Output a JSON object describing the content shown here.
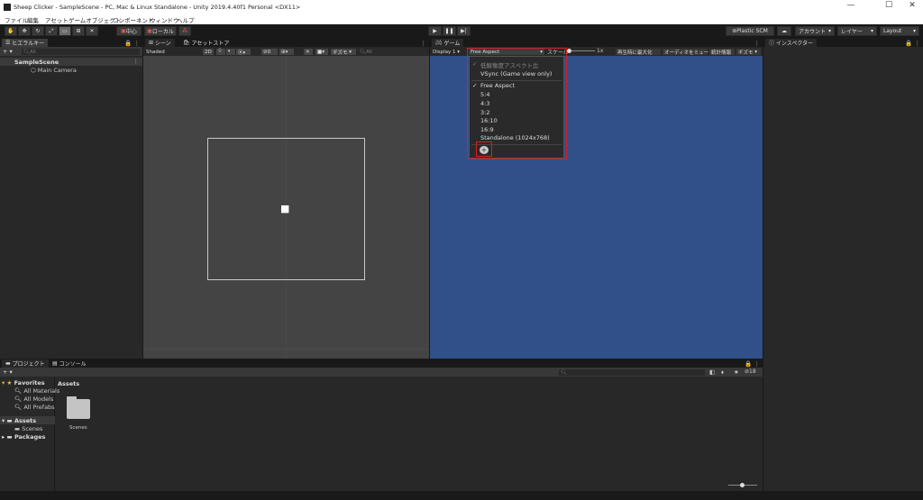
{
  "window": {
    "title": "Sheep Clicker - SampleScene - PC, Mac & Linux Standalone - Unity 2019.4.40f1 Personal <DX11>",
    "minimize": "—",
    "maximize": "☐",
    "close": "✕"
  },
  "menu": [
    "ファイル",
    "編集",
    "アセット",
    "ゲームオブジェクト",
    "コンポーネント",
    "ウィンドウ",
    "ヘルプ"
  ],
  "toolbar": {
    "pivot": "中心",
    "space": "ローカル",
    "plastic": "Plastic SCM",
    "account": "アカウント",
    "layers": "レイヤー",
    "layout": "Layout"
  },
  "hierarchy": {
    "tab": "ヒエラルキー",
    "add": "+ ▾",
    "search_placeholder": "All",
    "scene": "SampleScene",
    "items": [
      "Main Camera"
    ]
  },
  "scene": {
    "tabs": [
      "シーン",
      "アセットストア"
    ],
    "shading": "Shaded",
    "mode2d": "2D",
    "fx": "0",
    "gizmos": "ギズモ",
    "search_placeholder": "All"
  },
  "game": {
    "tab": "ゲーム",
    "display": "Display 1",
    "aspect": "Free Aspect",
    "scale_label": "スケール",
    "scale_value": "1x",
    "maximize": "再生時に最大化",
    "mute": "オーディオをミュート",
    "stats": "統計情報",
    "gizmos": "ギズモ",
    "bg": "#31508a"
  },
  "aspect_dropdown": {
    "items": [
      "低解像度アスペクト比",
      "VSync (Game view only)",
      "Free Aspect",
      "5:4",
      "4:3",
      "3:2",
      "16:10",
      "16:9",
      "Standalone (1024x768)"
    ],
    "checked": [
      "低解像度アスペクト比",
      "Free Aspect"
    ],
    "add_icon": "plus-icon"
  },
  "inspector": {
    "tab": "インスペクター"
  },
  "project": {
    "tabs": [
      "プロジェクト",
      "コンソール"
    ],
    "add": "+ ▾",
    "favorites": "Favorites",
    "fav_items": [
      "All Materials",
      "All Models",
      "All Prefabs"
    ],
    "assets": "Assets",
    "assets_children": [
      "Scenes"
    ],
    "packages": "Packages",
    "breadcrumb": "Assets",
    "folders": [
      "Scenes"
    ],
    "count": "18"
  }
}
